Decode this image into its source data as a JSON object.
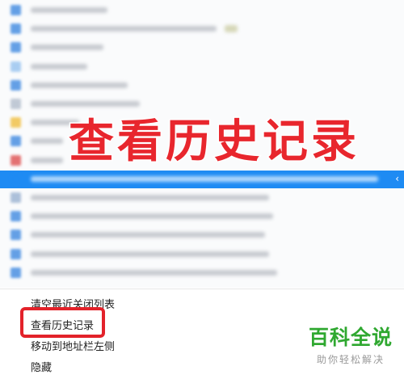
{
  "history_list": {
    "rows": [
      {
        "icon_color": "#4a90e2",
        "bar_w": 95
      },
      {
        "icon_color": "#4a90e2",
        "bar_w": 230
      },
      {
        "icon_color": "#4a90e2",
        "bar_w": 90
      },
      {
        "icon_color": "#9cc6f0",
        "bar_w": 70
      },
      {
        "icon_color": "#4a90e2",
        "bar_w": 120
      },
      {
        "icon_color": "#b7c1cf",
        "bar_w": 135
      },
      {
        "icon_color": "#f1c24a",
        "bar_w": 60
      },
      {
        "icon_color": "#4a90e2",
        "bar_w": 40
      },
      {
        "icon_color": "#e05a5a",
        "bar_w": 40
      },
      {
        "icon_color": "#1e8bf3",
        "bar_w": 430
      },
      {
        "icon_color": "#9fb6d3",
        "bar_w": 295
      },
      {
        "icon_color": "#4a90e2",
        "bar_w": 300
      },
      {
        "icon_color": "#4a90e2",
        "bar_w": 290
      },
      {
        "icon_color": "#4a90e2",
        "bar_w": 295
      },
      {
        "icon_color": "#4a90e2",
        "bar_w": 305
      }
    ],
    "selected_index": 9
  },
  "overlay": {
    "title": "查看历史记录",
    "color": "#e8262d"
  },
  "context_menu": {
    "items": [
      {
        "label": "清空最近关闭列表"
      },
      {
        "label": "查看历史记录"
      },
      {
        "label": "移动到地址栏左侧"
      },
      {
        "label": "隐藏"
      }
    ],
    "highlight_color": "#e3222a"
  },
  "watermark": {
    "title": "百科全说",
    "subtitle": "助你轻松解决"
  }
}
